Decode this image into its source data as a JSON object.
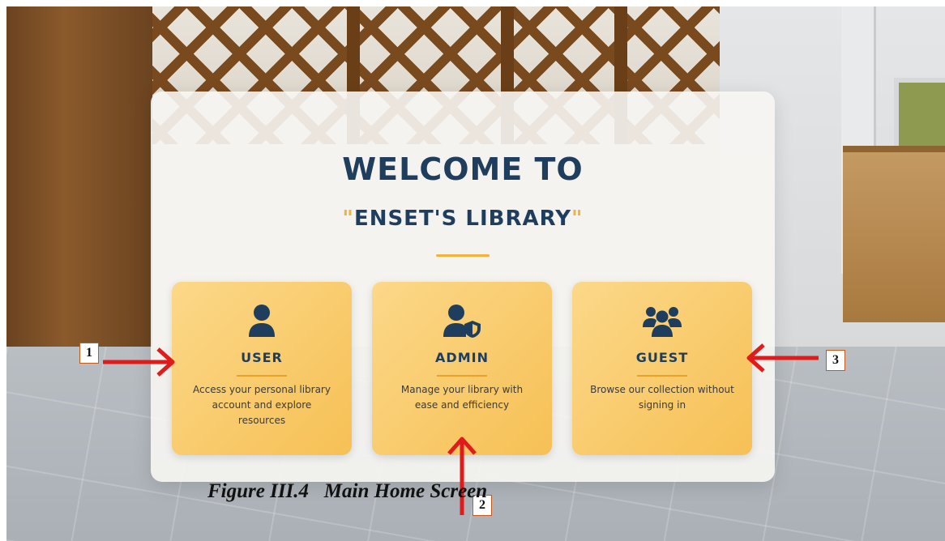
{
  "welcome": {
    "title": "WELCOME TO",
    "quote_open": "\"",
    "library_name": "ENSET'S LIBRARY",
    "quote_close": "\""
  },
  "roles": [
    {
      "label": "USER",
      "description": "Access your personal library account and explore resources",
      "icon": "user-icon"
    },
    {
      "label": "ADMIN",
      "description": "Manage your library with ease and efficiency",
      "icon": "user-shield-icon"
    },
    {
      "label": "GUEST",
      "description": "Browse our collection without signing in",
      "icon": "users-group-icon"
    }
  ],
  "annotations": {
    "callouts": [
      "1",
      "2",
      "3"
    ],
    "arrow_color": "#e01b1b"
  },
  "caption": "Figure III.4   Main Home Screen",
  "colors": {
    "navy": "#1f3d5c",
    "gold": "#f2b33d",
    "card_gradient_start": "#fcd889",
    "card_gradient_end": "#f6c055"
  }
}
